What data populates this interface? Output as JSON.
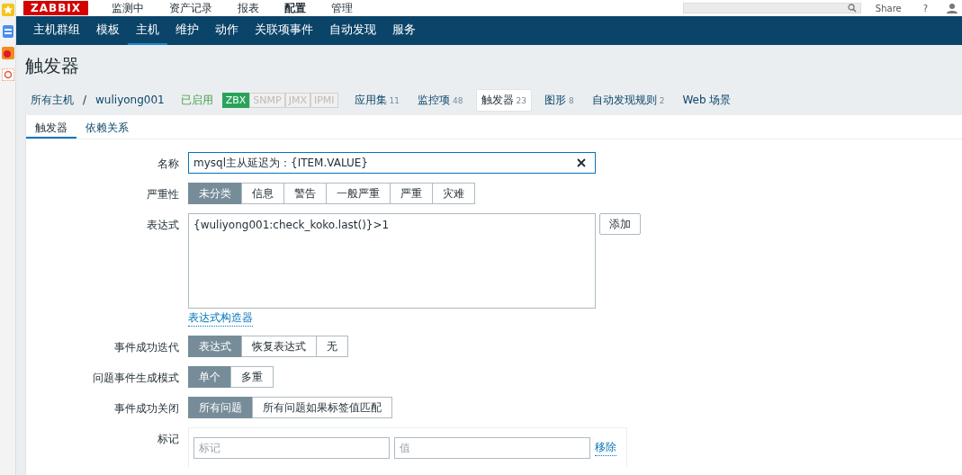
{
  "top_menu": [
    {
      "label": "监测中",
      "selected": false
    },
    {
      "label": "资产记录",
      "selected": false
    },
    {
      "label": "报表",
      "selected": false
    },
    {
      "label": "配置",
      "selected": true
    },
    {
      "label": "管理",
      "selected": false
    }
  ],
  "logo": "ZABBIX",
  "share": "Share",
  "help": "?",
  "sub_menu": [
    {
      "label": "主机群组",
      "selected": false
    },
    {
      "label": "模板",
      "selected": false
    },
    {
      "label": "主机",
      "selected": true
    },
    {
      "label": "维护",
      "selected": false
    },
    {
      "label": "动作",
      "selected": false
    },
    {
      "label": "关联项事件",
      "selected": false
    },
    {
      "label": "自动发现",
      "selected": false
    },
    {
      "label": "服务",
      "selected": false
    }
  ],
  "page_title": "触发器",
  "breadcrumb": {
    "all_hosts": "所有主机",
    "separator": "/",
    "host": "wuliyong001",
    "status": "已启用",
    "availability": [
      {
        "label": "ZBX",
        "on": true
      },
      {
        "label": "SNMP",
        "on": false
      },
      {
        "label": "JMX",
        "on": false
      },
      {
        "label": "IPMI",
        "on": false
      }
    ],
    "links": [
      {
        "label": "应用集",
        "count": "11",
        "selected": false
      },
      {
        "label": "监控项",
        "count": "48",
        "selected": false
      },
      {
        "label": "触发器",
        "count": "23",
        "selected": true
      },
      {
        "label": "图形",
        "count": "8",
        "selected": false
      },
      {
        "label": "自动发现规则",
        "count": "2",
        "selected": false
      },
      {
        "label": "Web 场景",
        "selected": false
      }
    ]
  },
  "tabs": [
    {
      "label": "触发器",
      "selected": true
    },
    {
      "label": "依赖关系",
      "selected": false
    }
  ],
  "form": {
    "name": {
      "label": "名称",
      "value": "mysql主从延迟为：{ITEM.VALUE}"
    },
    "severity": {
      "label": "严重性",
      "options": [
        {
          "label": "未分类",
          "selected": true
        },
        {
          "label": "信息",
          "selected": false
        },
        {
          "label": "警告",
          "selected": false
        },
        {
          "label": "一般严重",
          "selected": false
        },
        {
          "label": "严重",
          "selected": false
        },
        {
          "label": "灾难",
          "selected": false
        }
      ]
    },
    "expression": {
      "label": "表达式",
      "value": "{wuliyong001:check_koko.last()}>1",
      "add_button": "添加",
      "constructor_link": "表达式构造器"
    },
    "recovery": {
      "label": "事件成功迭代",
      "options": [
        {
          "label": "表达式",
          "selected": true
        },
        {
          "label": "恢复表达式",
          "selected": false
        },
        {
          "label": "无",
          "selected": false
        }
      ]
    },
    "generation": {
      "label": "问题事件生成模式",
      "options": [
        {
          "label": "单个",
          "selected": true
        },
        {
          "label": "多重",
          "selected": false
        }
      ]
    },
    "close": {
      "label": "事件成功关闭",
      "options": [
        {
          "label": "所有问题",
          "selected": true
        },
        {
          "label": "所有问题如果标签值匹配",
          "selected": false
        }
      ]
    },
    "tags": {
      "label": "标记",
      "tag_placeholder": "标记",
      "value_placeholder": "值",
      "remove": "移除"
    }
  }
}
